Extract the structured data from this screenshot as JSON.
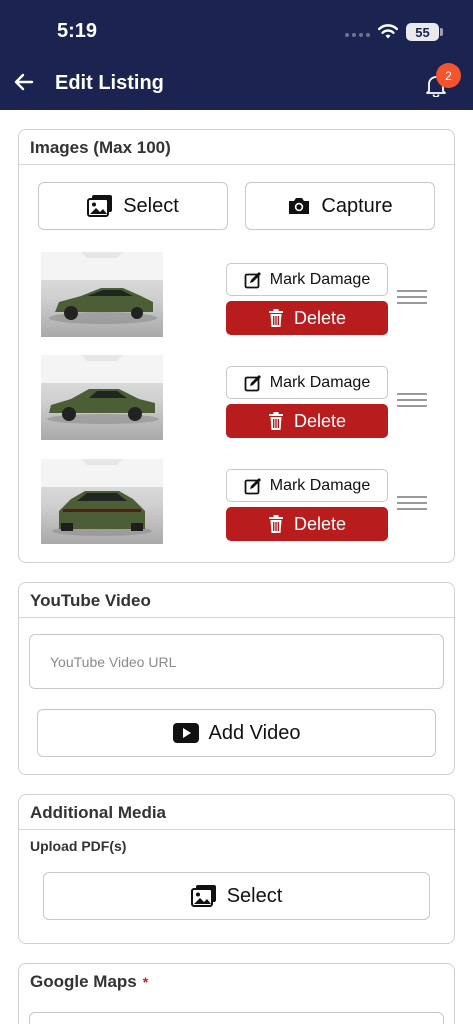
{
  "status_bar": {
    "time": "5:19",
    "battery": "55"
  },
  "header": {
    "title": "Edit Listing",
    "notification_count": "2"
  },
  "images_section": {
    "title": "Images (Max 100)",
    "select_label": "Select",
    "capture_label": "Capture",
    "items": [
      {
        "image_icon": "car-front-three-quarter-photo",
        "mark_label": "Mark Damage",
        "delete_label": "Delete"
      },
      {
        "image_icon": "car-side-photo",
        "mark_label": "Mark Damage",
        "delete_label": "Delete"
      },
      {
        "image_icon": "car-rear-photo",
        "mark_label": "Mark Damage",
        "delete_label": "Delete"
      }
    ]
  },
  "youtube_section": {
    "title": "YouTube Video",
    "url_placeholder": "YouTube Video URL",
    "add_label": "Add Video"
  },
  "additional_media": {
    "title": "Additional Media",
    "upload_label": "Upload PDF(s)",
    "select_label": "Select"
  },
  "google_maps": {
    "title": "Google Maps",
    "required_mark": "*"
  },
  "colors": {
    "header_bg": "#1b2350",
    "delete_red": "#b91c1c",
    "badge_orange": "#f2542d",
    "car_green": "#4c5e36"
  }
}
